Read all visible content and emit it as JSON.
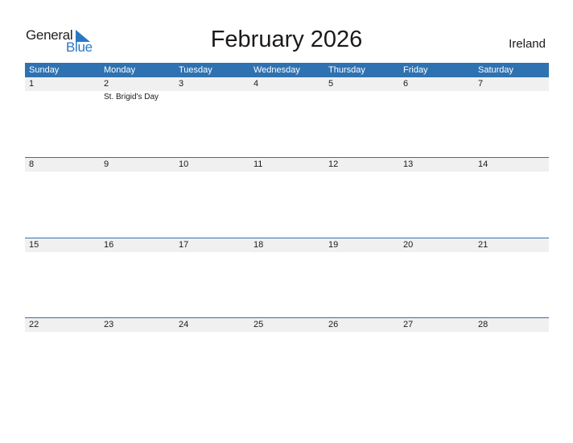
{
  "logo": {
    "word1": "General",
    "word2": "Blue"
  },
  "title": "February 2026",
  "country": "Ireland",
  "colors": {
    "header_bg": "#2e72b1",
    "date_strip_bg": "#f0f0f0",
    "logo_blue": "#2a78c2"
  },
  "weekdays": [
    "Sunday",
    "Monday",
    "Tuesday",
    "Wednesday",
    "Thursday",
    "Friday",
    "Saturday"
  ],
  "weeks": [
    {
      "days": [
        "1",
        "2",
        "3",
        "4",
        "5",
        "6",
        "7"
      ],
      "events": [
        "",
        "St. Brigid's Day",
        "",
        "",
        "",
        "",
        ""
      ]
    },
    {
      "days": [
        "8",
        "9",
        "10",
        "11",
        "12",
        "13",
        "14"
      ],
      "events": [
        "",
        "",
        "",
        "",
        "",
        "",
        ""
      ]
    },
    {
      "days": [
        "15",
        "16",
        "17",
        "18",
        "19",
        "20",
        "21"
      ],
      "events": [
        "",
        "",
        "",
        "",
        "",
        "",
        ""
      ]
    },
    {
      "days": [
        "22",
        "23",
        "24",
        "25",
        "26",
        "27",
        "28"
      ],
      "events": [
        "",
        "",
        "",
        "",
        "",
        "",
        ""
      ]
    }
  ]
}
